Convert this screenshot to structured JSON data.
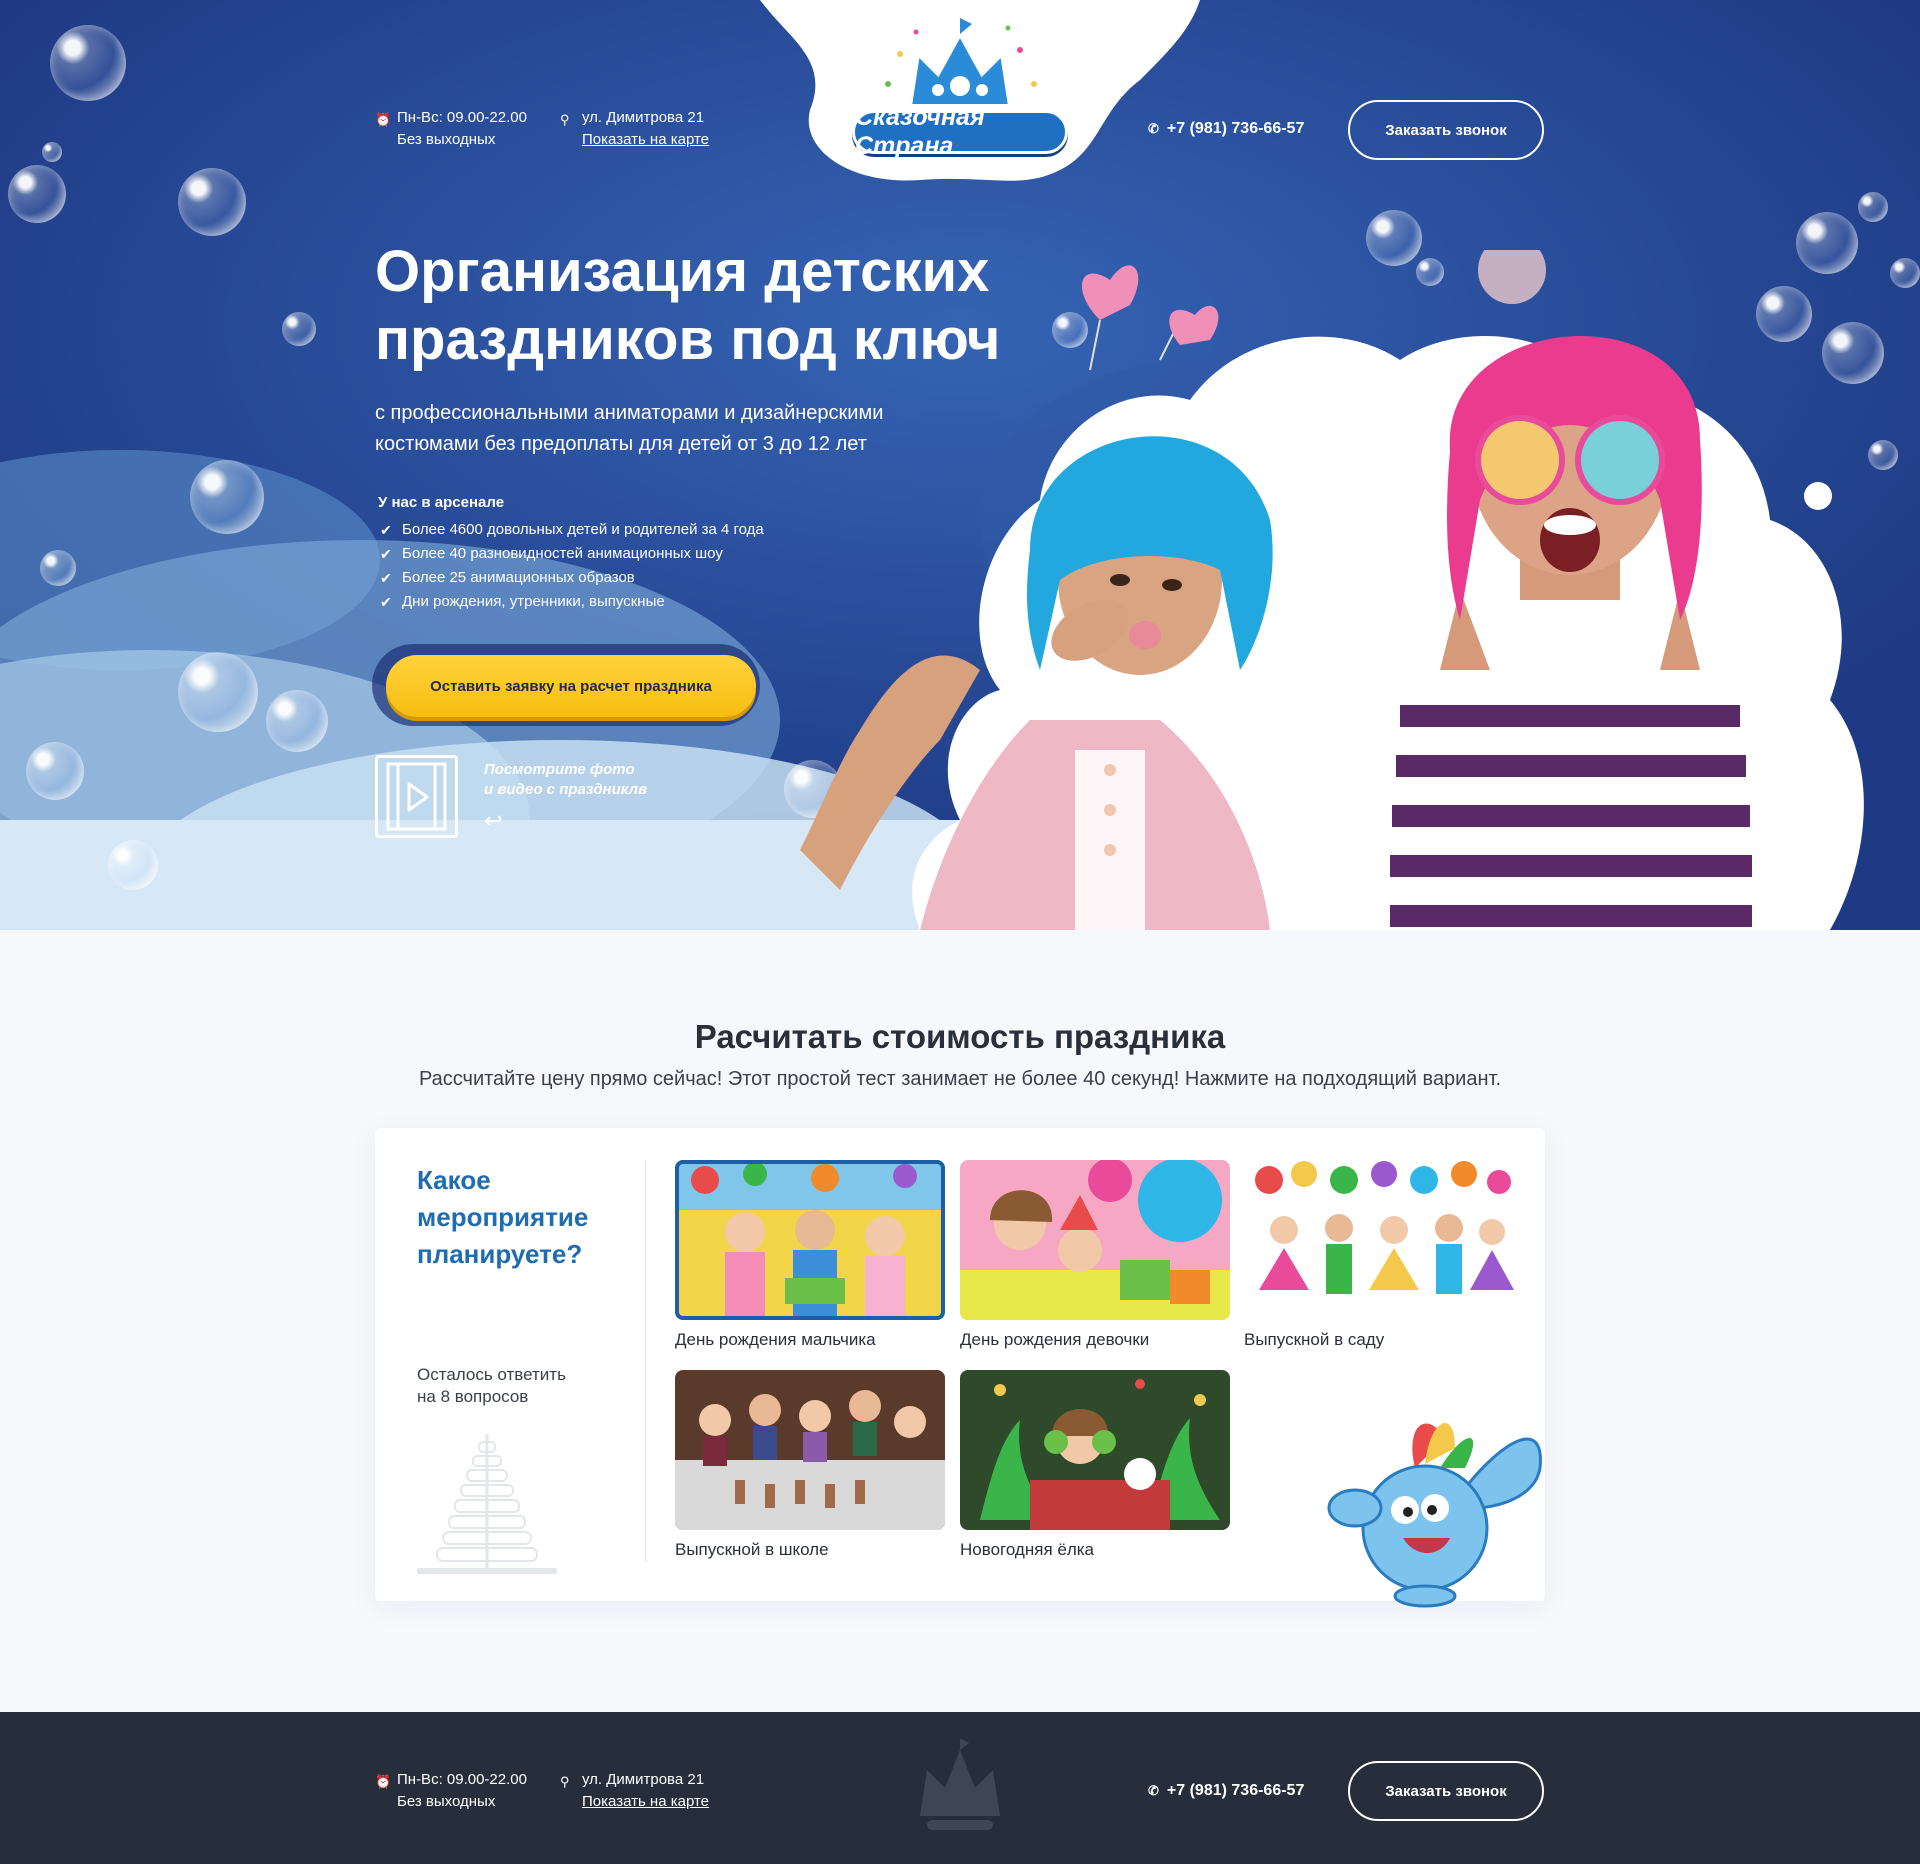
{
  "header": {
    "hours": "Пн-Вс: 09.00-22.00",
    "hours_note": "Без выходных",
    "address": "ул. Димитрова 21",
    "map_link": "Показать на карте",
    "phone": "+7 (981) 736-66-57",
    "call_button": "Заказать звонок",
    "logo_text": "Сказочная Страна"
  },
  "hero": {
    "title_line1": "Организация детских",
    "title_line2": "праздников под ключ",
    "subtitle": "с профессиональными аниматорами и дизайнерскими костюмами без предоплаты для детей от 3 до 12 лет",
    "arsenal_title": "У нас в арсенале",
    "arsenal_items": [
      "Более 4600 довольных детей и родителей за  4 года",
      "Более 40 разновидностей анимационных шоу",
      "Более 25 анимационных образов",
      "Дни рождения, утренники, выпускные"
    ],
    "cta": "Оставить заявку на расчет праздника",
    "video_line1": "Посмотрите фото",
    "video_line2": "и видео с праздниклв"
  },
  "calc": {
    "title": "Расчитать стоимость праздника",
    "subtitle": "Рассчитайте цену прямо сейчас! Этот простой тест занимает не более 40 секунд! Нажмите на подходящий вариант.",
    "question": "Какое мероприятие планируете?",
    "remain_line1": "Осталось ответить",
    "remain_line2": "на 8 вопросов",
    "options": [
      {
        "label": "День рождения мальчика"
      },
      {
        "label": "День рождения девочки"
      },
      {
        "label": "Выпускной в саду"
      },
      {
        "label": "Выпускной в школе"
      },
      {
        "label": "Новогодняя ёлка"
      }
    ]
  },
  "footer": {
    "hours": "Пн-Вс: 09.00-22.00",
    "hours_note": "Без выходных",
    "address": "ул. Димитрова 21",
    "map_link": "Показать на карте",
    "phone": "+7 (981) 736-66-57",
    "call_button": "Заказать звонок"
  },
  "colors": {
    "hero_bg": "#23418d",
    "accent_yellow": "#f8bd10",
    "question_blue": "#1f6cb0",
    "footer_bg": "#272e3b"
  }
}
